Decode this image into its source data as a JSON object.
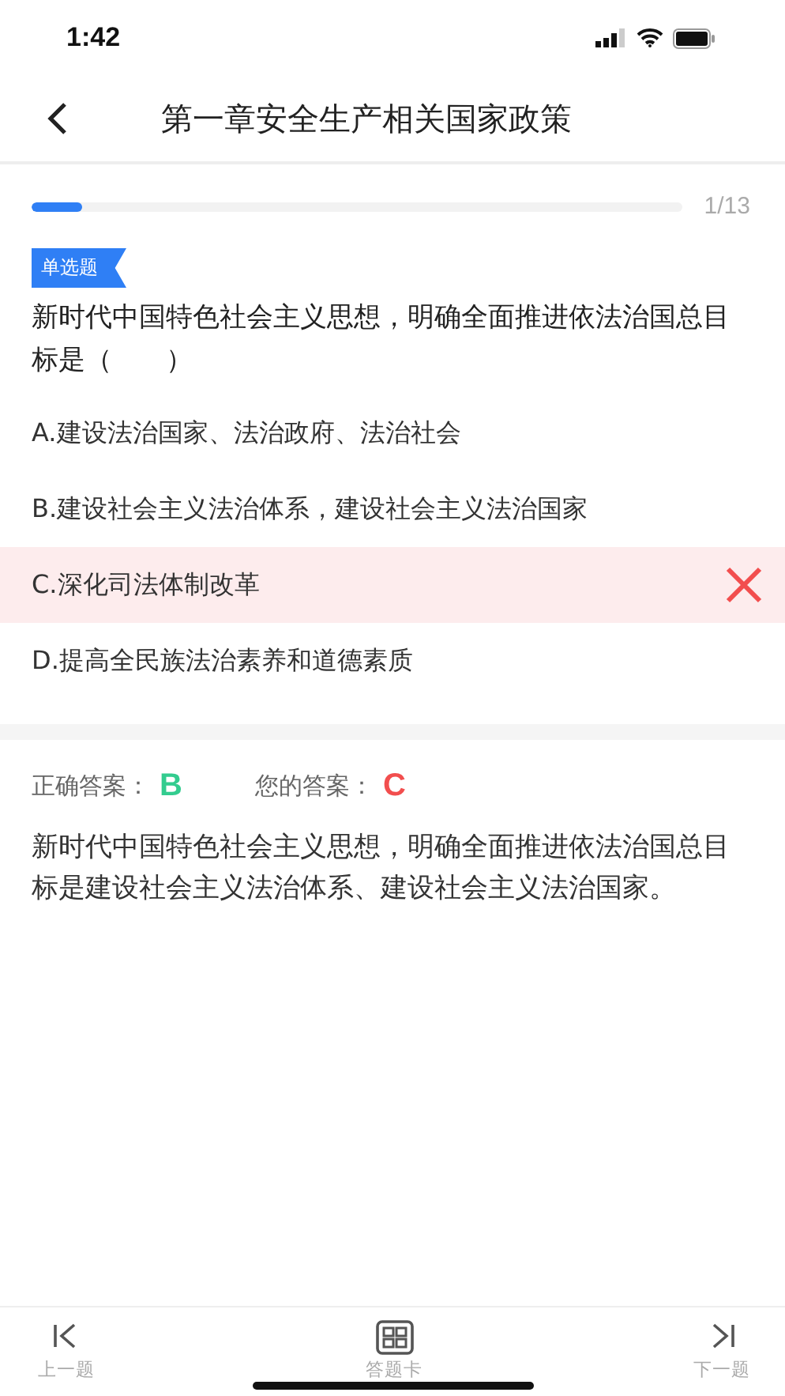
{
  "status_bar": {
    "time": "1:42"
  },
  "header": {
    "title": "第一章安全生产相关国家政策"
  },
  "progress": {
    "level": 0.077,
    "count": "1/13"
  },
  "question": {
    "type_tag": "单选题",
    "text": "新时代中国特色社会主义思想，明确全面推进依法治国总目标是（　　）",
    "options": [
      {
        "text": "A.建设法治国家、法治政府、法治社会",
        "selected": false
      },
      {
        "text": "B.建设社会主义法治体系，建设社会主义法治国家",
        "selected": false
      },
      {
        "text": "C.深化司法体制改革",
        "selected": true
      },
      {
        "text": "D.提高全民族法治素养和道德素质",
        "selected": false
      }
    ]
  },
  "answer": {
    "correct_label": "正确答案：",
    "correct_value": "B",
    "yours_label": "您的答案：",
    "yours_value": "C",
    "explanation": "新时代中国特色社会主义思想，明确全面推进依法治国总目标是建设社会主义法治体系、建设社会主义法治国家。"
  },
  "bottom_bar": [
    {
      "kind": "prev",
      "label": "上一题"
    },
    {
      "kind": "card",
      "label": "答题卡"
    },
    {
      "kind": "next",
      "label": "下一题"
    }
  ]
}
